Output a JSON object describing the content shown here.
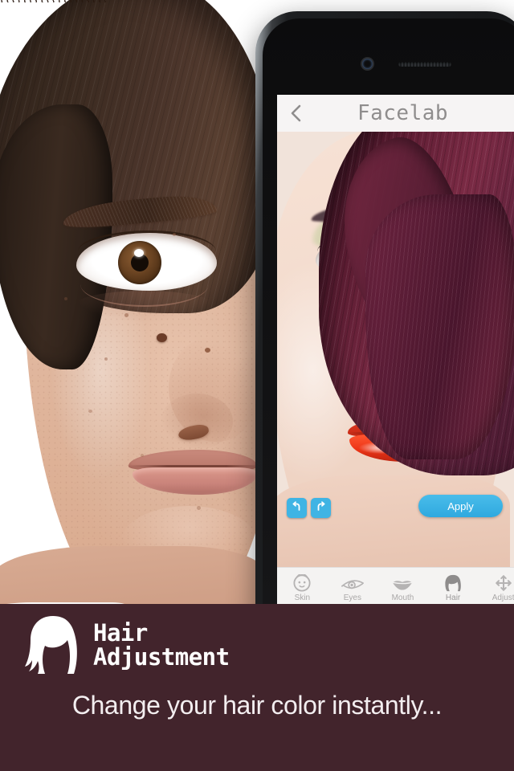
{
  "app": {
    "navbar": {
      "back_icon": "chevron-left-icon",
      "title": "Facelab"
    },
    "editor": {
      "undo_label": "undo",
      "redo_label": "redo",
      "apply_label": "Apply"
    },
    "toolbar": [
      {
        "label": "Skin",
        "icon": "skin-face-icon",
        "active": false
      },
      {
        "label": "Eyes",
        "icon": "eye-icon",
        "active": false
      },
      {
        "label": "Mouth",
        "icon": "lips-icon",
        "active": false
      },
      {
        "label": "Hair",
        "icon": "hair-bob-icon",
        "active": true
      },
      {
        "label": "Adjust",
        "icon": "move-arrows-icon",
        "active": false
      }
    ]
  },
  "device": {
    "camera_icon": "front-camera-icon",
    "speaker_icon": "earpiece-speaker-icon",
    "home_icon": "home-button-icon"
  },
  "photo": {
    "before_caption": "before-half-face-original",
    "after_caption": "after-half-face-retouched"
  },
  "banner": {
    "logo_icon": "hair-silhouette-icon",
    "title_line1": "Hair",
    "title_line2": "Adjustment",
    "tagline": "Change your hair color instantly..."
  },
  "colors": {
    "banner_bg": "#42242c",
    "accent_blue": "#3fb4e4",
    "navbar_bg": "#f6f4f4",
    "toolbar_bg": "#f4f3f2",
    "hair_after": "#7a2a44",
    "lips_after": "#ec3517",
    "eye_after": "#2f86b5",
    "eyeshadow_after": "#78af50"
  }
}
